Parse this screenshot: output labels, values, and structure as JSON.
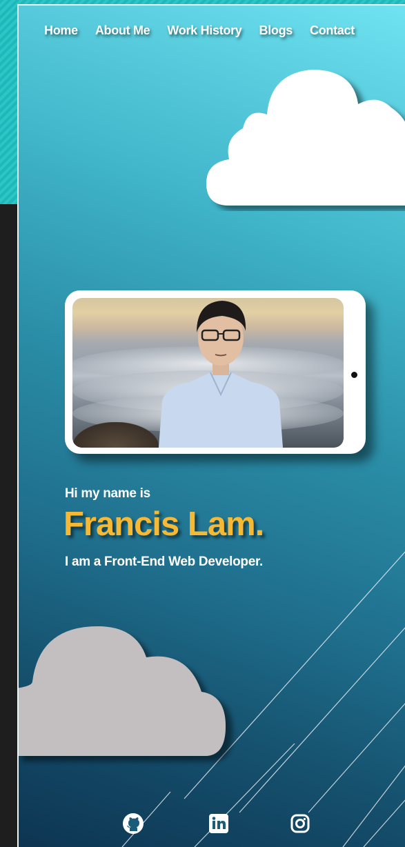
{
  "nav": {
    "items": [
      {
        "label": "Home"
      },
      {
        "label": "About Me"
      },
      {
        "label": "Work History"
      },
      {
        "label": "Blogs"
      },
      {
        "label": "Contact"
      }
    ]
  },
  "hero": {
    "greeting": "Hi my name is",
    "name": "Francis Lam.",
    "role": "I am a Front-End Web Developer."
  },
  "social": {
    "icons": [
      "github-icon",
      "linkedin-icon",
      "instagram-icon"
    ]
  },
  "colors": {
    "accent": "#f5b935",
    "gradient_light": "#6fe3f1",
    "gradient_dark": "#0d3552",
    "cloud_top": "#ffffff",
    "cloud_bottom": "#c3bfc0"
  }
}
